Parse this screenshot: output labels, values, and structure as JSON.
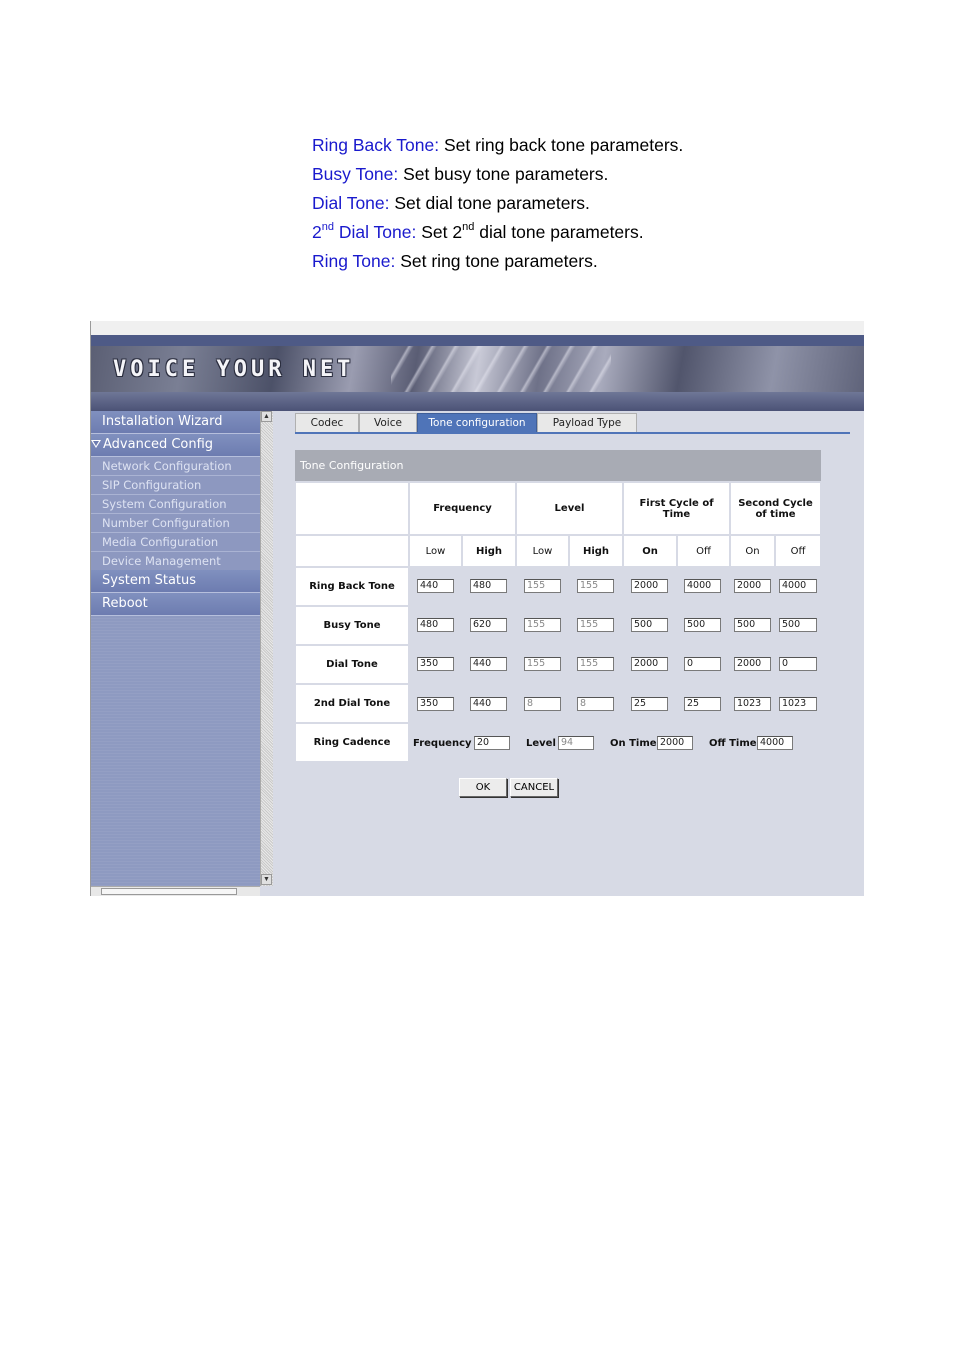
{
  "doc_lines": [
    {
      "term": "Ring Back Tone:",
      "desc": " Set ring back tone parameters."
    },
    {
      "term": "Busy Tone:",
      "desc": " Set busy tone parameters."
    },
    {
      "term": "Dial Tone:",
      "desc": " Set dial tone parameters."
    },
    {
      "term_pre": "2",
      "term_sup": "nd",
      "term_post": " Dial Tone:",
      "desc_pre": " Set 2",
      "desc_sup": "nd",
      "desc_post": " dial tone parameters."
    },
    {
      "term": "Ring Tone:",
      "desc": " Set ring tone parameters."
    }
  ],
  "banner": {
    "brand": "VOICE YOUR NET"
  },
  "sidebar": {
    "installation_wizard": "Installation Wizard",
    "advanced_config": "Advanced Config",
    "sub_items": [
      "Network Configuration",
      "SIP Configuration",
      "System Configuration",
      "Number Configuration",
      "Media Configuration",
      "Device Management"
    ],
    "system_status": "System Status",
    "reboot": "Reboot"
  },
  "tabs": [
    "Codec",
    "Voice",
    "Tone configuration",
    "Payload Type"
  ],
  "active_tab": "Tone configuration",
  "table": {
    "title": "Tone Configuration",
    "group_headers": [
      "Frequency",
      "Level",
      "First Cycle of Time",
      "Second Cycle of time"
    ],
    "sub_headers": [
      "Low",
      "High",
      "Low",
      "High",
      "On",
      "Off",
      "On",
      "Off"
    ],
    "rows": [
      {
        "label": "Ring Back Tone",
        "values": [
          "440",
          "480",
          "155",
          "155",
          "2000",
          "4000",
          "2000",
          "4000"
        ]
      },
      {
        "label": "Busy Tone",
        "values": [
          "480",
          "620",
          "155",
          "155",
          "500",
          "500",
          "500",
          "500"
        ]
      },
      {
        "label": "Dial Tone",
        "values": [
          "350",
          "440",
          "155",
          "155",
          "2000",
          "0",
          "2000",
          "0"
        ]
      },
      {
        "label": "2nd Dial Tone",
        "values": [
          "350",
          "440",
          "8",
          "8",
          "25",
          "25",
          "1023",
          "1023"
        ]
      }
    ],
    "ring_cadence": {
      "label": "Ring Cadence",
      "frequency_label": "Frequency",
      "frequency": "20",
      "level_label": "Level",
      "level": "94",
      "on_time_label": "On Time",
      "on_time": "2000",
      "off_time_label": "Off Time",
      "off_time": "4000"
    }
  },
  "buttons": {
    "ok": "OK",
    "cancel": "CANCEL"
  }
}
